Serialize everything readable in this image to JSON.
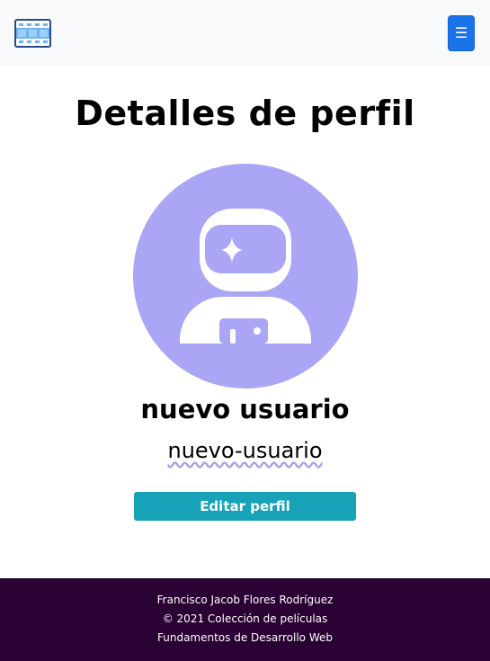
{
  "navbar": {
    "brand_icon": "film-strip-icon",
    "menu_icon": "hamburger-menu-icon",
    "menu_glyph": "☰",
    "background": "#f8f9fa",
    "toggle_color": "#1a73e8"
  },
  "profile": {
    "title": "Detalles de perfil",
    "avatar_icon": "astronaut-icon",
    "avatar_color": "#aba5f6",
    "display_name": "nuevo usuario",
    "username": "nuevo-usuario",
    "edit_label": "Editar perfil",
    "edit_color": "#17a2b8"
  },
  "footer": {
    "author": "Francisco Jacob Flores Rodríguez",
    "copyright": "© 2021 Colección de películas",
    "course": "Fundamentos de Desarrollo Web",
    "background": "#2a0233"
  }
}
